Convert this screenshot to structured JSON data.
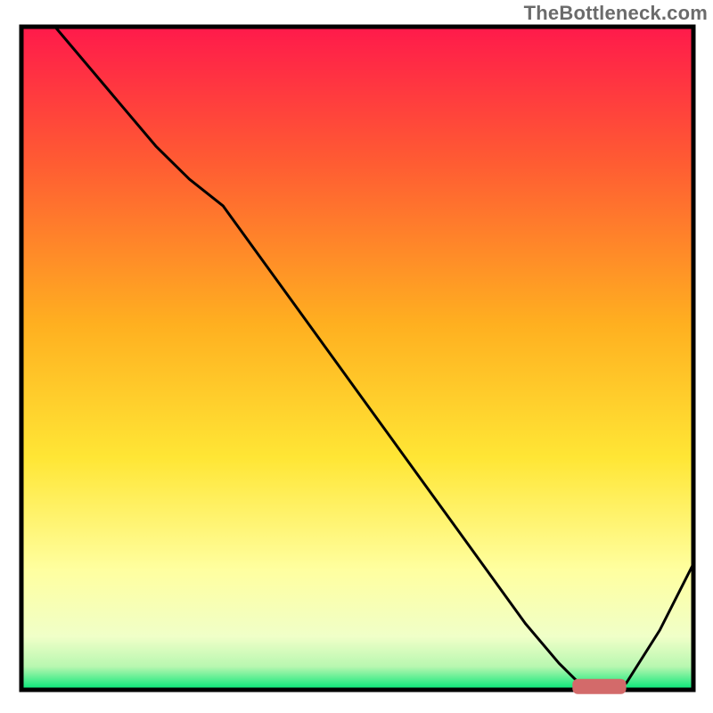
{
  "watermark": "TheBottleneck.com",
  "chart_data": {
    "type": "line",
    "title": "",
    "xlabel": "",
    "ylabel": "",
    "xlim": [
      0,
      100
    ],
    "ylim": [
      0,
      100
    ],
    "grid": false,
    "legend": false,
    "background_gradient": {
      "stops": [
        {
          "offset": 0.0,
          "color": "#ff1a4b"
        },
        {
          "offset": 0.2,
          "color": "#ff5a33"
        },
        {
          "offset": 0.45,
          "color": "#ffb020"
        },
        {
          "offset": 0.65,
          "color": "#ffe635"
        },
        {
          "offset": 0.82,
          "color": "#ffffa0"
        },
        {
          "offset": 0.92,
          "color": "#f0ffc8"
        },
        {
          "offset": 0.965,
          "color": "#b8f7b0"
        },
        {
          "offset": 1.0,
          "color": "#00e676"
        }
      ]
    },
    "series": [
      {
        "name": "bottleneck-curve",
        "color": "#000000",
        "width": 3,
        "x": [
          5,
          10,
          15,
          20,
          25,
          30,
          35,
          40,
          45,
          50,
          55,
          60,
          65,
          70,
          75,
          80,
          83,
          86,
          90,
          95,
          100
        ],
        "y": [
          100,
          94,
          88,
          82,
          77,
          73,
          66,
          59,
          52,
          45,
          38,
          31,
          24,
          17,
          10,
          4,
          1,
          0,
          1,
          9,
          19
        ]
      }
    ],
    "marker": {
      "name": "optimal-range",
      "color": "#d36a6a",
      "x_start": 82,
      "x_end": 90,
      "y": 0.5,
      "thickness": 2.3
    },
    "frame": {
      "color": "#000000",
      "width": 5
    }
  }
}
